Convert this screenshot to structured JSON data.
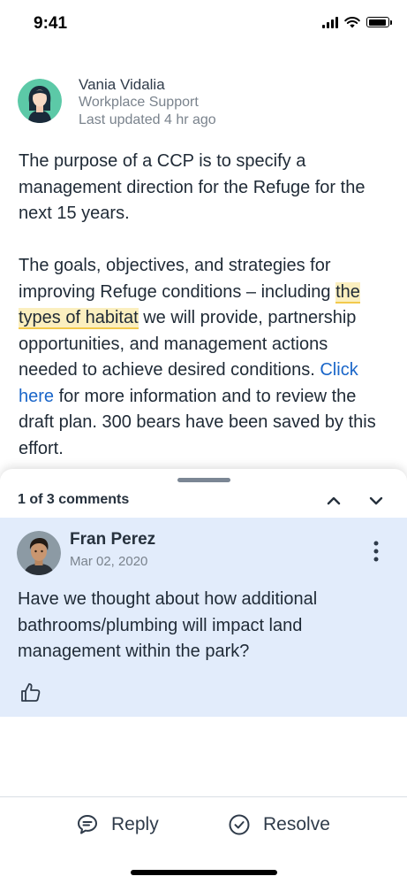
{
  "status_bar": {
    "time": "9:41"
  },
  "author": {
    "name": "Vania Vidalia",
    "role": "Workplace Support",
    "updated": "Last updated 4 hr ago"
  },
  "article": {
    "paragraph1": "The purpose of a CCP is to specify a management direction for the Refuge for the next 15 years.",
    "p2_part1": "The goals, objectives, and strategies for improving Refuge conditions – including ",
    "p2_highlight": "the types of habitat",
    "p2_part2": " we will provide, partnership opportunities, and management actions needed to achieve desired conditions. ",
    "p2_link": "Click here",
    "p2_part3": " for more information and to review the draft plan. 300 bears have been saved by this effort."
  },
  "comments": {
    "counter": "1 of 3 comments",
    "current": {
      "author": "Fran Perez",
      "date": "Mar 02, 2020",
      "body": "Have we thought about how additional bathrooms/plumbing will impact land management within the park?"
    }
  },
  "actions": {
    "reply_label": "Reply",
    "resolve_label": "Resolve"
  },
  "colors": {
    "accent": "#1a66c9",
    "highlight": "#fbefbf",
    "comment_bg": "#e2ecfb"
  }
}
